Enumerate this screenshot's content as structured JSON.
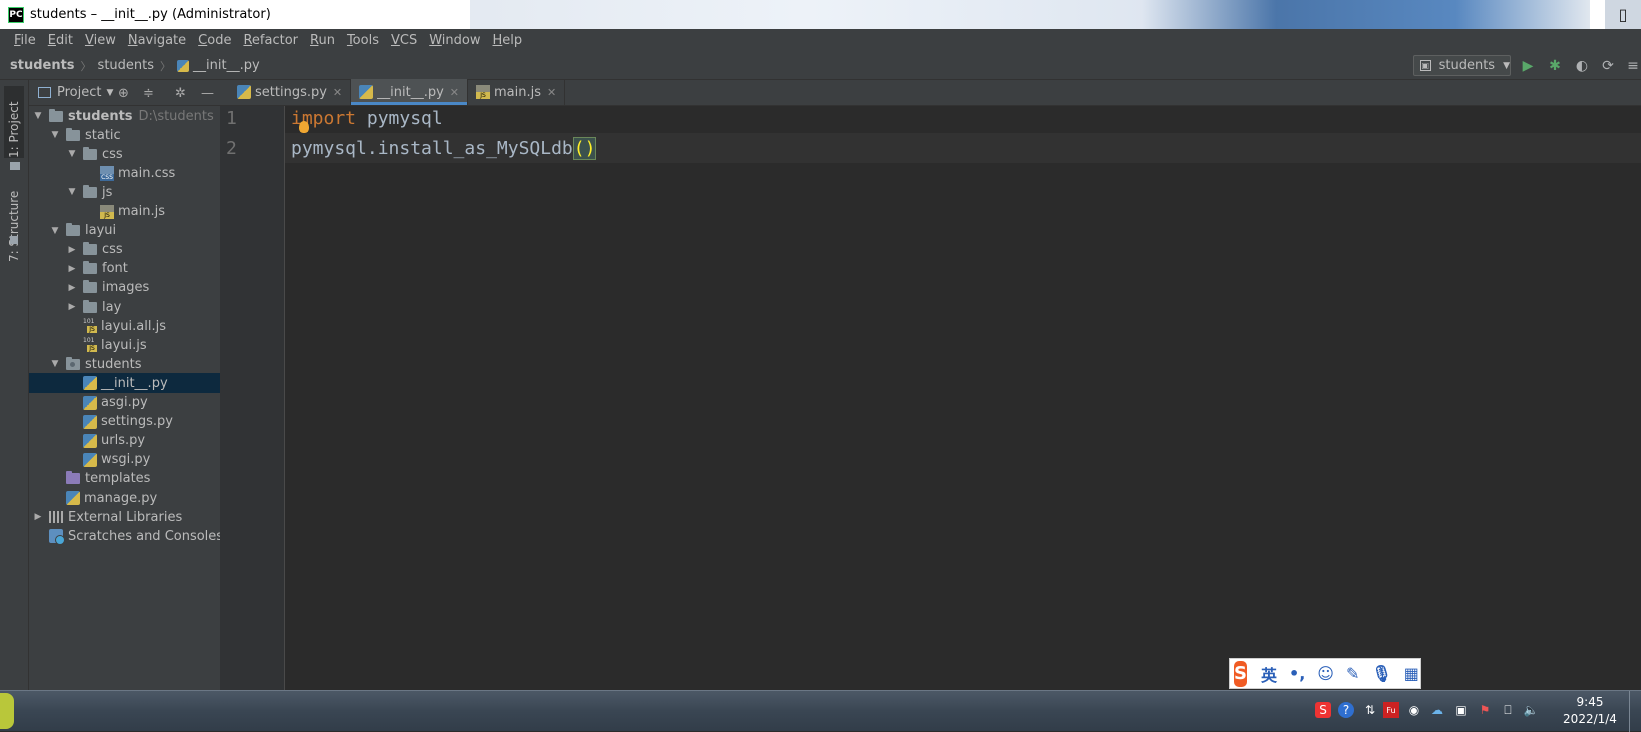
{
  "window": {
    "logo": "PC",
    "title": "students – __init__.py (Administrator)"
  },
  "menu": [
    {
      "label": "File",
      "key": "F",
      "rest": "ile"
    },
    {
      "label": "Edit",
      "key": "E",
      "rest": "dit"
    },
    {
      "label": "View",
      "key": "V",
      "rest": "iew"
    },
    {
      "label": "Navigate",
      "key": "N",
      "rest": "avigate"
    },
    {
      "label": "Code",
      "key": "C",
      "rest": "ode"
    },
    {
      "label": "Refactor",
      "key": "R",
      "rest": "efactor"
    },
    {
      "label": "Run",
      "key": "R",
      "rest": "un"
    },
    {
      "label": "Tools",
      "key": "T",
      "rest": "ools"
    },
    {
      "label": "VCS",
      "key": "V",
      "rest": "CS"
    },
    {
      "label": "Window",
      "key": "W",
      "rest": "indow"
    },
    {
      "label": "Help",
      "key": "H",
      "rest": "elp"
    }
  ],
  "breadcrumb": [
    "students",
    "students",
    "__init__.py"
  ],
  "run_config": {
    "label": "students"
  },
  "left_strip": {
    "project_tab": "1: Project",
    "structure_tab": "7: Structure"
  },
  "project_panel": {
    "header": "Project"
  },
  "tree": [
    {
      "label": "students",
      "hint": "D:\\students",
      "bold": true,
      "icon": "folder",
      "expanded": true
    },
    {
      "label": "static",
      "icon": "folder",
      "expanded": true
    },
    {
      "label": "css",
      "icon": "folder",
      "expanded": true
    },
    {
      "label": "main.css",
      "icon": "css"
    },
    {
      "label": "js",
      "icon": "folder",
      "expanded": true
    },
    {
      "label": "main.js",
      "icon": "js"
    },
    {
      "label": "layui",
      "icon": "folder",
      "expanded": true
    },
    {
      "label": "css",
      "icon": "folder",
      "expanded": false
    },
    {
      "label": "font",
      "icon": "folder",
      "expanded": false
    },
    {
      "label": "images",
      "icon": "folder",
      "expanded": false
    },
    {
      "label": "lay",
      "icon": "folder",
      "expanded": false
    },
    {
      "label": "layui.all.js",
      "icon": "bin"
    },
    {
      "label": "layui.js",
      "icon": "bin"
    },
    {
      "label": "students",
      "icon": "package",
      "expanded": true
    },
    {
      "label": "__init__.py",
      "icon": "py",
      "selected": true
    },
    {
      "label": "asgi.py",
      "icon": "py"
    },
    {
      "label": "settings.py",
      "icon": "py"
    },
    {
      "label": "urls.py",
      "icon": "py"
    },
    {
      "label": "wsgi.py",
      "icon": "py"
    },
    {
      "label": "templates",
      "icon": "template-folder"
    },
    {
      "label": "manage.py",
      "icon": "py"
    },
    {
      "label": "External Libraries",
      "icon": "library",
      "expanded": false
    },
    {
      "label": "Scratches and Consoles",
      "icon": "scratch"
    }
  ],
  "tabs": [
    {
      "label": "settings.py",
      "icon": "py",
      "active": false
    },
    {
      "label": "__init__.py",
      "icon": "py",
      "active": true
    },
    {
      "label": "main.js",
      "icon": "js",
      "active": false
    }
  ],
  "editor": {
    "lines": [
      {
        "num": "1",
        "keyword": "import",
        "rest": " pymysql"
      },
      {
        "num": "2",
        "code": "pymysql.install_as_MySQLdb",
        "paren": "()"
      }
    ]
  },
  "ime": {
    "logo": "S",
    "lang": "英",
    "punct": "•,"
  },
  "clock": {
    "time": "9:45",
    "date": "2022/1/4"
  },
  "colors": {
    "keyword": "#cc7832",
    "code": "#a9b7c6",
    "accent": "#4a88c7",
    "selection": "#0d293e"
  }
}
